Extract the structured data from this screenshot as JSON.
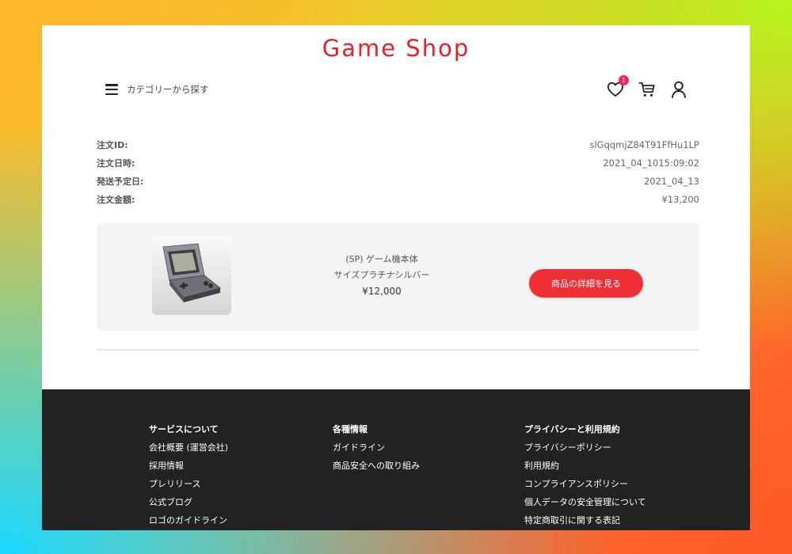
{
  "header": {
    "logo": "Game Shop",
    "category_label": "カテゴリーから探す",
    "favorites_count": "1"
  },
  "order": {
    "rows": [
      {
        "label": "注文ID:",
        "value": "slGqqmjZ84T91FfHu1LP"
      },
      {
        "label": "注文日時:",
        "value": "2021_04_1015:09:02"
      },
      {
        "label": "発送予定日:",
        "value": "2021_04_13"
      },
      {
        "label": "注文金額:",
        "value": "¥13,200"
      }
    ]
  },
  "product": {
    "name_line1": "(SP) ゲーム機本体",
    "name_line2": "サイズプラチナシルバー",
    "price": "¥12,000",
    "detail_button": "商品の詳細を見る"
  },
  "footer": {
    "columns": [
      {
        "title": "サービスについて",
        "links": [
          "会社概要 (運営会社)",
          "採用情報",
          "プレリリース",
          "公式ブログ",
          "ロゴのガイドライン"
        ]
      },
      {
        "title": "各種情報",
        "links": [
          "ガイドライン",
          "商品安全への取り組み"
        ]
      },
      {
        "title": "プライバシーと利用規約",
        "links": [
          "プライバシーポリシー",
          "利用規約",
          "コンプライアンスポリシー",
          "個人データの安全管理について",
          "特定商取引に関する表記"
        ]
      }
    ]
  },
  "colors": {
    "brand_red": "#e8202a",
    "button_red": "#ee2f35",
    "badge_pink": "#f0285a",
    "footer_bg": "#222222"
  },
  "icons": [
    "hamburger-menu-icon",
    "heart-icon",
    "cart-icon",
    "user-icon"
  ]
}
